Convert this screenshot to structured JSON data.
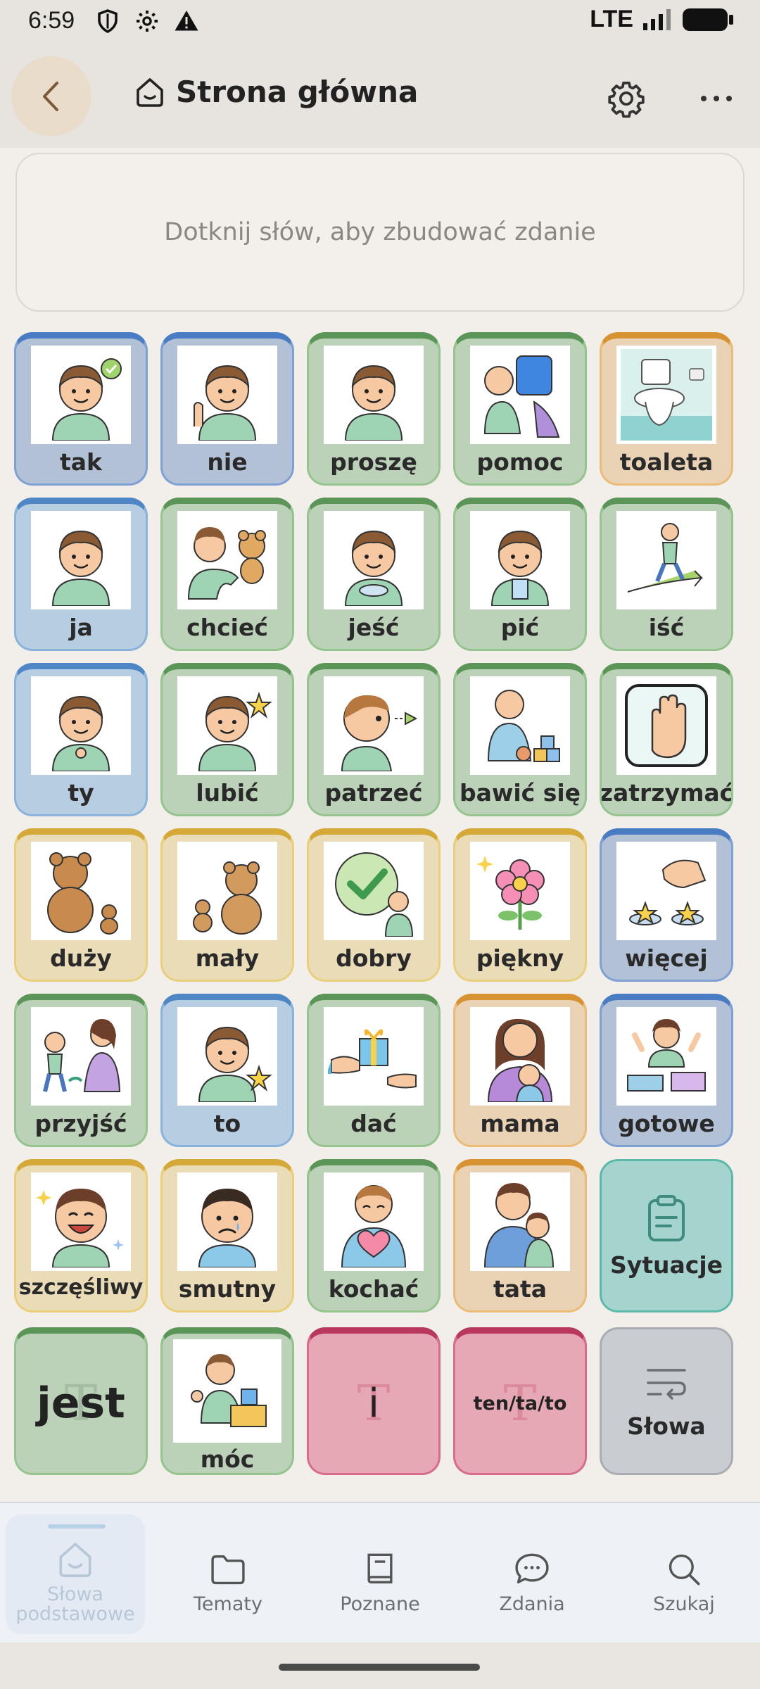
{
  "status_bar": {
    "time": "6:59",
    "network": "LTE"
  },
  "app_bar": {
    "title": "Strona główna"
  },
  "sentence": {
    "placeholder": "Dotknij słów, aby zbudować zdanie"
  },
  "tiles": [
    {
      "label": "tak",
      "color": "blue",
      "icon": "yes-icon"
    },
    {
      "label": "nie",
      "color": "blue",
      "icon": "no-icon"
    },
    {
      "label": "proszę",
      "color": "green",
      "icon": "please-icon"
    },
    {
      "label": "pomoc",
      "color": "green",
      "icon": "help-icon"
    },
    {
      "label": "toaleta",
      "color": "orange",
      "icon": "toilet-icon"
    },
    {
      "label": "ja",
      "color": "lblue",
      "icon": "me-icon"
    },
    {
      "label": "chcieć",
      "color": "green",
      "icon": "want-icon"
    },
    {
      "label": "jeść",
      "color": "green",
      "icon": "eat-icon"
    },
    {
      "label": "pić",
      "color": "green",
      "icon": "drink-icon"
    },
    {
      "label": "iść",
      "color": "green",
      "icon": "go-icon"
    },
    {
      "label": "ty",
      "color": "lblue",
      "icon": "you-icon"
    },
    {
      "label": "lubić",
      "color": "green",
      "icon": "like-icon"
    },
    {
      "label": "patrzeć",
      "color": "green",
      "icon": "look-icon"
    },
    {
      "label": "bawić się",
      "color": "green",
      "icon": "play-icon"
    },
    {
      "label": "zatrzymać",
      "color": "green",
      "icon": "stop-hand-icon"
    },
    {
      "label": "duży",
      "color": "yellow",
      "icon": "big-bear-icon"
    },
    {
      "label": "mały",
      "color": "yellow",
      "icon": "small-bear-icon"
    },
    {
      "label": "dobry",
      "color": "yellow",
      "icon": "good-check-icon"
    },
    {
      "label": "piękny",
      "color": "yellow",
      "icon": "flower-icon"
    },
    {
      "label": "więcej",
      "color": "blue",
      "icon": "more-stars-icon"
    },
    {
      "label": "przyjść",
      "color": "green",
      "icon": "come-icon"
    },
    {
      "label": "to",
      "color": "lblue",
      "icon": "this-icon"
    },
    {
      "label": "dać",
      "color": "green",
      "icon": "give-gift-icon"
    },
    {
      "label": "mama",
      "color": "orange",
      "icon": "mom-icon"
    },
    {
      "label": "gotowe",
      "color": "blue",
      "icon": "done-icon"
    },
    {
      "label": "szczęśliwy",
      "color": "yellow",
      "icon": "happy-face-icon"
    },
    {
      "label": "smutny",
      "color": "yellow",
      "icon": "sad-face-icon"
    },
    {
      "label": "kochać",
      "color": "green",
      "icon": "love-heart-icon"
    },
    {
      "label": "tata",
      "color": "orange",
      "icon": "dad-icon"
    }
  ],
  "special_tiles": {
    "situations": "Sytuacje",
    "jest": "jest",
    "moc": "móc",
    "i": "i",
    "tentato": "ten/ta/to",
    "words": "Słowa"
  },
  "bottom_nav": [
    {
      "label": "Słowa podstawowe",
      "icon": "home-icon",
      "active": true
    },
    {
      "label": "Tematy",
      "icon": "folder-icon",
      "active": false
    },
    {
      "label": "Poznane",
      "icon": "book-icon",
      "active": false
    },
    {
      "label": "Zdania",
      "icon": "chat-icon",
      "active": false
    },
    {
      "label": "Szukaj",
      "icon": "search-icon",
      "active": false
    }
  ]
}
